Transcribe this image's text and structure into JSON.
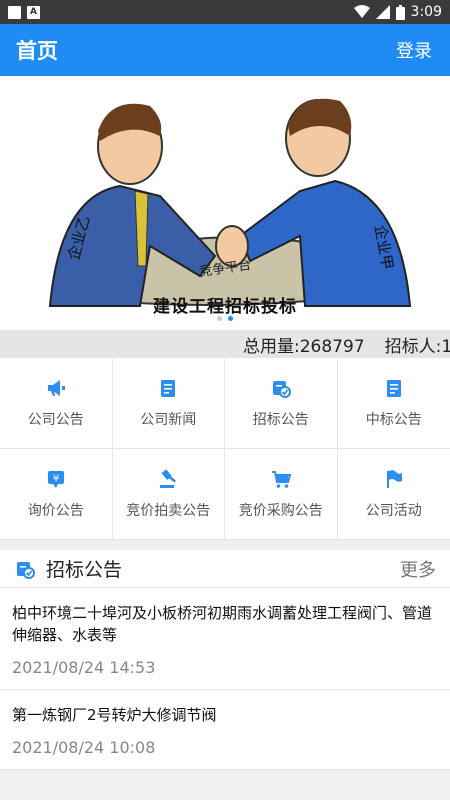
{
  "status_bar": {
    "time": "3:09"
  },
  "app_bar": {
    "title": "首页",
    "login": "登录"
  },
  "banner": {
    "caption": "建设工程招标投标",
    "sleeve_left": "企业乙",
    "sleeve_right": "企业甲",
    "table_text": "竞争平台"
  },
  "ticker": {
    "items": [
      "总用量:268797",
      "招标人:1"
    ]
  },
  "grid": {
    "items": [
      {
        "label": "公司公告",
        "icon": "megaphone-icon"
      },
      {
        "label": "公司新闻",
        "icon": "notepad-icon"
      },
      {
        "label": "招标公告",
        "icon": "checked-document-icon"
      },
      {
        "label": "中标公告",
        "icon": "notepad-icon"
      },
      {
        "label": "询价公告",
        "icon": "yen-message-icon"
      },
      {
        "label": "竞价拍卖公告",
        "icon": "gavel-icon"
      },
      {
        "label": "竞价采购公告",
        "icon": "cart-icon"
      },
      {
        "label": "公司活动",
        "icon": "flag-icon"
      }
    ]
  },
  "section": {
    "title": "招标公告",
    "more": "更多",
    "items": [
      {
        "title": "柏中环境二十埠河及小板桥河初期雨水调蓄处理工程阀门、管道伸缩器、水表等",
        "date": "2021/08/24  14:53"
      },
      {
        "title": "第一炼钢厂2号转炉大修调节阀",
        "date": "2021/08/24  10:08"
      }
    ]
  },
  "colors": {
    "accent": "#1f8cf6",
    "icon_blue": "#2b8ef0"
  }
}
